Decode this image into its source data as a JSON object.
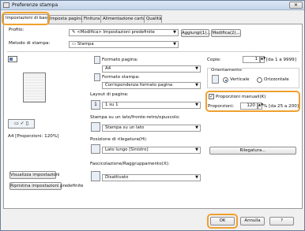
{
  "window": {
    "title": "Preferenze stampa",
    "close_label": "✕"
  },
  "tabs": [
    {
      "label": "Impostazioni di base"
    },
    {
      "label": "Imposta pagina"
    },
    {
      "label": "Finitura"
    },
    {
      "label": "Alimentazione carta"
    },
    {
      "label": "Qualità"
    }
  ],
  "profile": {
    "label": "Profilo:",
    "value": "<Modifica> Impostazioni predefinite",
    "add_label": "Aggiungi(1)...",
    "edit_label": "Modifica(2)..."
  },
  "output_method": {
    "label": "Metodo di stampa:",
    "value": "Stampa"
  },
  "page_size": {
    "label": "Formato pagina:",
    "value": "A4"
  },
  "output_size": {
    "label": "Formato stampa:",
    "value": "Corrispondenza formato pagina"
  },
  "copies": {
    "label": "Copie:",
    "value": "1",
    "range": "[da 1 a 9999]"
  },
  "orientation": {
    "label": "Orientamento",
    "vertical": "Verticale",
    "horizontal": "Orizzontale",
    "selected": "Verticale"
  },
  "manual_scaling": {
    "label": "Proporzioni manuali(K)",
    "checked": true,
    "scaling_label": "Proporzioni:",
    "value": "120",
    "range": "% [da 25 a 200]"
  },
  "page_layout": {
    "label": "Layout di pagina:",
    "value": "1 su 1"
  },
  "duplex": {
    "label": "Stampa su un lato/fronte-retro/opuscolo:",
    "value": "Stampa su un lato"
  },
  "binding": {
    "label": "Posizione di rilegatura(H):",
    "value": "Lato lungo [Sinistro]",
    "button": "Rilegatura..."
  },
  "collate": {
    "label": "Fascicolazione/Raggruppamento(X):",
    "value": "Disattivato"
  },
  "preview": {
    "caption": "A4 [Proporzioni: 120%]"
  },
  "left_buttons": {
    "view_settings": "Visualizza impostazioni",
    "restore_defaults": "Ripristina impostazioni predefinite"
  },
  "bottom_buttons": {
    "ok": "OK",
    "cancel": "Annulla",
    "help": "?"
  },
  "colors": {
    "highlight": "#f0a030",
    "title_bg": "#c4d5ea"
  }
}
